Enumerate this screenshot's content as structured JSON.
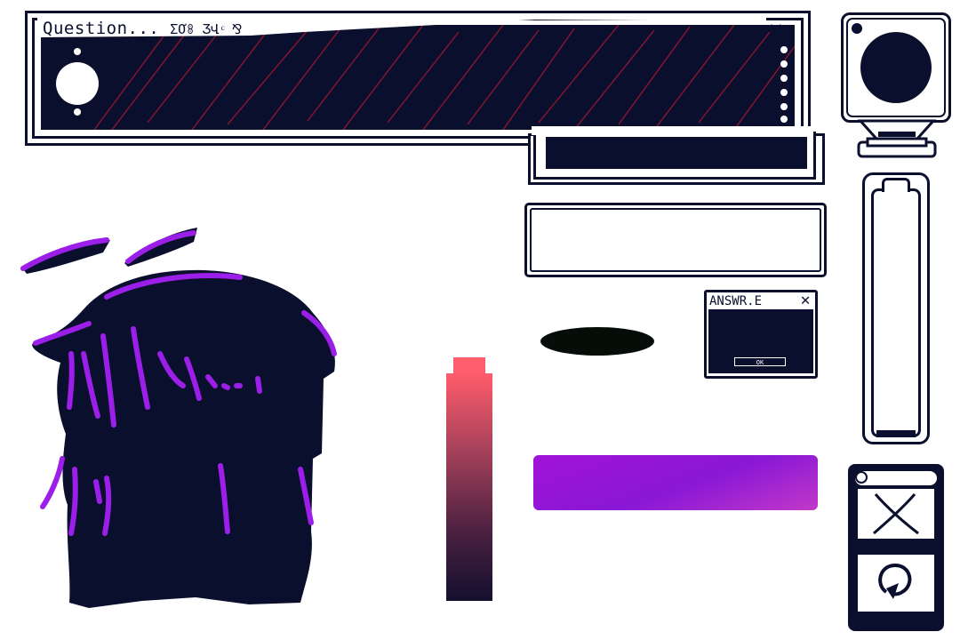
{
  "question_window": {
    "title": "Question...",
    "scribble_text": "ƩƠꗚ ƷՎ ͨ ⅋",
    "close_icon": "close-icon",
    "panel_color": "#0b0f2e",
    "stroke_color": "#8a1530"
  },
  "answer_dialog": {
    "title": "ANSWR.E",
    "ok_label": "OK",
    "close_icon": "close-icon"
  },
  "gradient_bars": {
    "vertical": {
      "top_color": "#ff5c6b",
      "bottom_color": "#14102e"
    },
    "horizontal": {
      "start_color": "#a012d8",
      "end_color": "#c238c8"
    }
  },
  "side_panel": {
    "monitor_icon": "camera-lens-icon",
    "capsule_icon": "battery-capsule-icon",
    "close_icon": "x-cross-icon",
    "refresh_icon": "refresh-icon"
  },
  "character": {
    "fill_color": "#0b0f2e",
    "accent_color": "#9b1fe8"
  },
  "colors": {
    "navy": "#0b0f2e",
    "purple": "#9b1fe8",
    "coral": "#ff5c6b",
    "oval_black": "#050d08"
  }
}
